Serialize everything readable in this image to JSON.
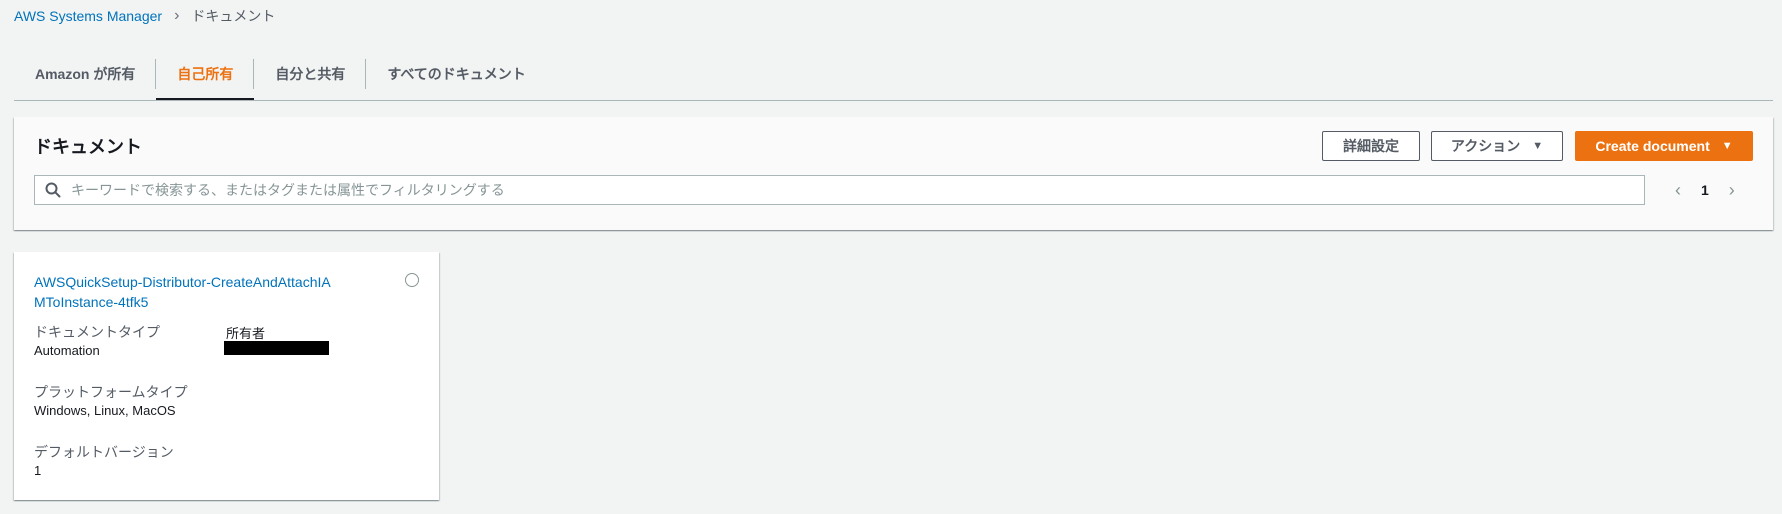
{
  "breadcrumb": {
    "root": "AWS Systems Manager",
    "current": "ドキュメント"
  },
  "tabs": [
    {
      "label": "Amazon が所有",
      "active": false
    },
    {
      "label": "自己所有",
      "active": true
    },
    {
      "label": "自分と共有",
      "active": false
    },
    {
      "label": "すべてのドキュメント",
      "active": false
    }
  ],
  "panel": {
    "title": "ドキュメント",
    "advanced_button": "詳細設定",
    "actions_button": "アクション",
    "create_button": "Create document",
    "search_placeholder": "キーワードで検索する、またはタグまたは属性でフィルタリングする",
    "page": "1"
  },
  "card": {
    "title": "AWSQuickSetup-Distributor-CreateAndAttachIAMToInstance-4tfk5",
    "doc_type_label": "ドキュメントタイプ",
    "doc_type_value": "Automation",
    "owner_label": "所有者",
    "platform_label": "プラットフォームタイプ",
    "platform_value": "Windows, Linux, MacOS",
    "default_version_label": "デフォルトバージョン",
    "default_version_value": "1"
  },
  "colors": {
    "accent": "#ec7211",
    "link": "#0073bb",
    "background": "#f2f3f3"
  },
  "icons": [
    "chevron-right-icon",
    "caret-down-icon",
    "search-icon",
    "chevron-left-icon",
    "radio-icon"
  ]
}
